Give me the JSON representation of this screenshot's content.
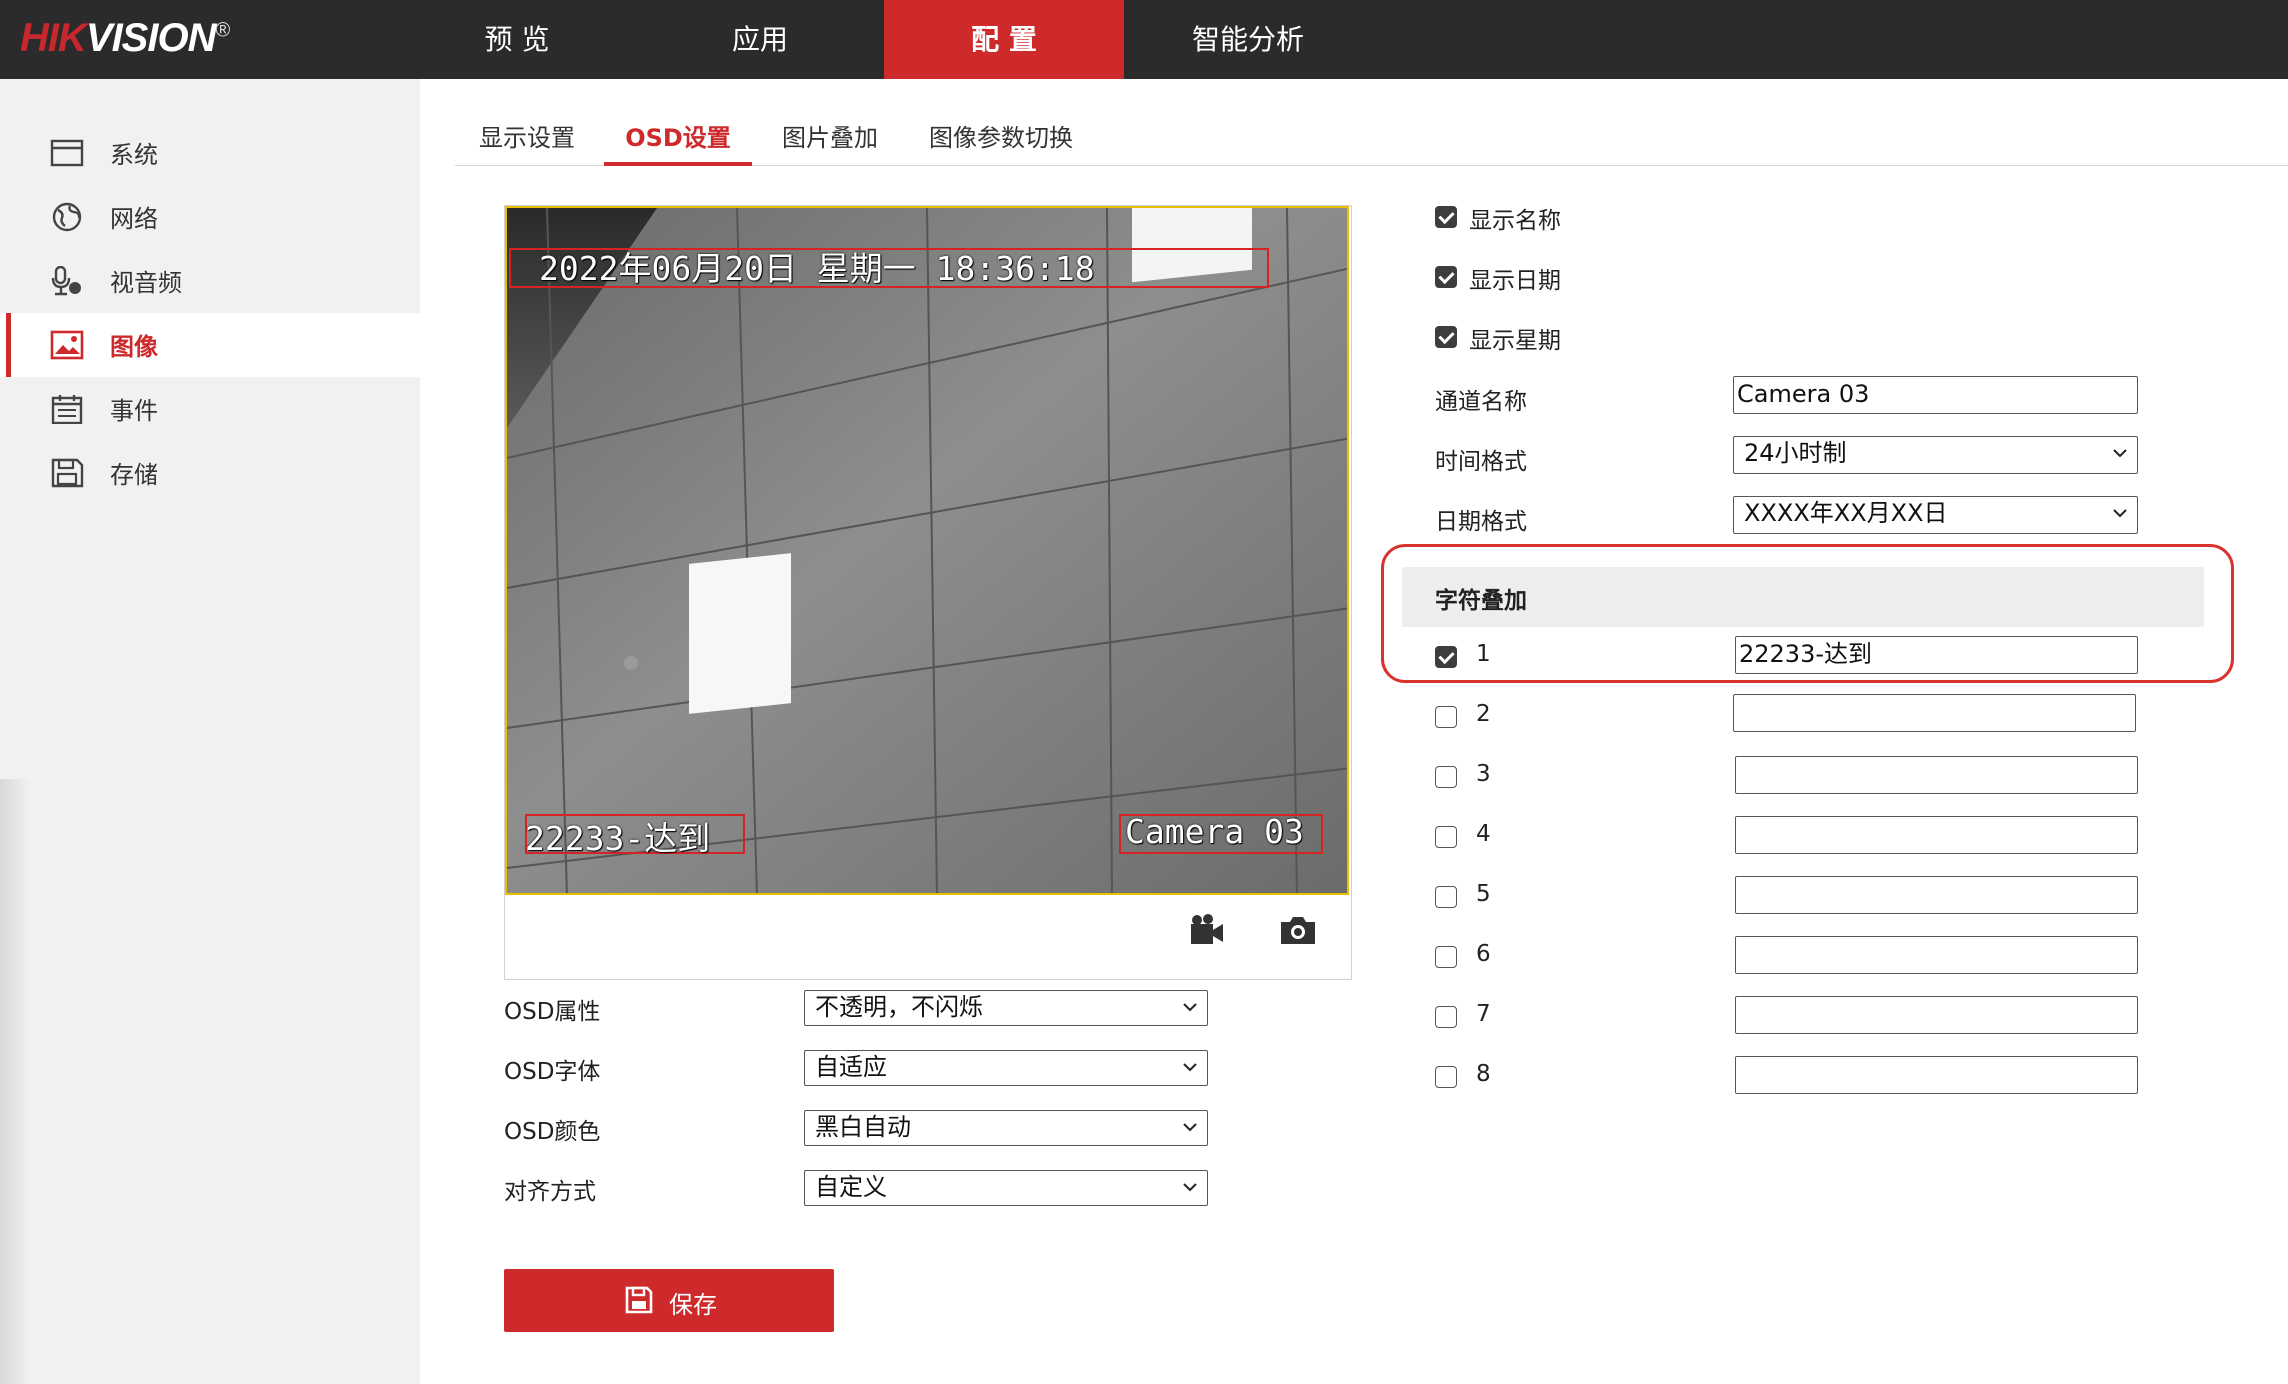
{
  "brand": {
    "logo_red": "HIK",
    "logo_white": "VISION",
    "registered": "®"
  },
  "nav": {
    "items": [
      "预 览",
      "应用",
      "配 置",
      "智能分析"
    ],
    "active_index": 2
  },
  "sidebar": {
    "items": [
      {
        "label": "系统",
        "icon": "system-icon"
      },
      {
        "label": "网络",
        "icon": "network-icon"
      },
      {
        "label": "视音频",
        "icon": "audio-video-icon"
      },
      {
        "label": "图像",
        "icon": "image-icon"
      },
      {
        "label": "事件",
        "icon": "event-icon"
      },
      {
        "label": "存储",
        "icon": "storage-icon"
      }
    ],
    "active_index": 3
  },
  "tabs": {
    "items": [
      "显示设置",
      "OSD设置",
      "图片叠加",
      "图像参数切换"
    ],
    "active_index": 1
  },
  "preview": {
    "osd_datetime": "2022年06月20日  星期一  18:36:18",
    "osd_overlay1": "22233-达到",
    "osd_channel": "Camera 03",
    "tools": [
      "record-icon",
      "snapshot-icon"
    ]
  },
  "osd_settings": {
    "attr_label": "OSD属性",
    "attr_value": "不透明，不闪烁",
    "font_label": "OSD字体",
    "font_value": "自适应",
    "color_label": "OSD颜色",
    "color_value": "黑白自动",
    "align_label": "对齐方式",
    "align_value": "自定义"
  },
  "display_options": {
    "show_name": {
      "label": "显示名称",
      "checked": true
    },
    "show_date": {
      "label": "显示日期",
      "checked": true
    },
    "show_week": {
      "label": "显示星期",
      "checked": true
    }
  },
  "channel": {
    "name_label": "通道名称",
    "name_value": "Camera 03",
    "time_label": "时间格式",
    "time_value": "24小时制",
    "date_label": "日期格式",
    "date_value": "XXXX年XX月XX日"
  },
  "overlay": {
    "title": "字符叠加",
    "rows": [
      {
        "num": "1",
        "checked": true,
        "value": "22233-达到"
      },
      {
        "num": "2",
        "checked": false,
        "value": ""
      },
      {
        "num": "3",
        "checked": false,
        "value": ""
      },
      {
        "num": "4",
        "checked": false,
        "value": ""
      },
      {
        "num": "5",
        "checked": false,
        "value": ""
      },
      {
        "num": "6",
        "checked": false,
        "value": ""
      },
      {
        "num": "7",
        "checked": false,
        "value": ""
      },
      {
        "num": "8",
        "checked": false,
        "value": ""
      }
    ]
  },
  "save": {
    "label": "保存"
  },
  "colors": {
    "accent": "#cf2a2b",
    "topbar": "#2b2b2b",
    "sidebar": "#f1f1f1",
    "highlight": "#d8332d"
  }
}
